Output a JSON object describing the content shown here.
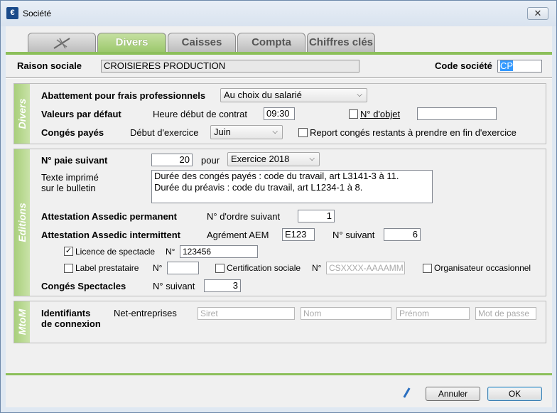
{
  "window": {
    "title": "Société",
    "close": "✕",
    "app_icon": "€"
  },
  "tabs": [
    {
      "label": ""
    },
    {
      "label": "Divers"
    },
    {
      "label": "Caisses"
    },
    {
      "label": "Compta"
    },
    {
      "label": "Chiffres clés"
    }
  ],
  "header": {
    "raison_label": "Raison sociale",
    "raison_value": "CROISIERES PRODUCTION",
    "code_label": "Code société",
    "code_value": "CP"
  },
  "divers": {
    "tab_label": "Divers",
    "abattement_label": "Abattement pour frais professionnels",
    "abattement_value": "Au choix du salarié",
    "valeurs_label": "Valeurs par défaut",
    "heure_label": "Heure début de contrat",
    "heure_value": "09:30",
    "objet_label": "N° d'objet",
    "objet_value": "",
    "conges_label": "Congés payés",
    "debut_label": "Début d'exercice",
    "debut_value": "Juin",
    "report_label": "Report congés restants à prendre en fin d'exercice"
  },
  "editions": {
    "tab_label": "Editions",
    "paie_label": "N° paie suivant",
    "paie_value": "20",
    "pour_label": "pour",
    "exercice_value": "Exercice 2018",
    "texte_label1": "Texte imprimé",
    "texte_label2": "sur le bulletin",
    "texte_line1": "Durée des congés payés : code du travail, art L3141-3 à 11.",
    "texte_line2": "Durée du préavis : code du travail, art L1234-1 à 8.",
    "assedic_perm_label": "Attestation Assedic permanent",
    "ordre_label": "N° d'ordre suivant",
    "ordre_value": "1",
    "assedic_int_label": "Attestation Assedic intermittent",
    "aem_label": "Agrément AEM",
    "aem_value": "E123",
    "suivant_label": "N° suivant",
    "suivant_value": "6",
    "licence_label": "Licence de spectacle",
    "licence_no_label": "N°",
    "licence_value": "123456",
    "label_prest": "Label prestataire",
    "label_no": "N°",
    "label_value": "",
    "certif_label": "Certification sociale",
    "certif_no": "N°",
    "certif_placeholder": "CSXXXX-AAAAMM",
    "organisateur_label": "Organisateur occasionnel",
    "cs_label": "Congés Spectacles",
    "cs_suivant_label": "N° suivant",
    "cs_value": "3"
  },
  "mtom": {
    "tab_label": "MtoM",
    "ident_label1": "Identifiants",
    "ident_label2": "de connexion",
    "net_label": "Net-entreprises",
    "siret": "Siret",
    "nom": "Nom",
    "prenom": "Prénom",
    "mdp": "Mot de passe"
  },
  "footer": {
    "annuler": "Annuler",
    "ok": "OK"
  }
}
